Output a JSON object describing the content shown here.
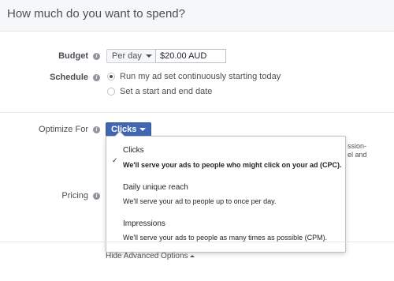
{
  "header": {
    "title": "How much do you want to spend?"
  },
  "budget": {
    "label": "Budget",
    "period_value": "Per day",
    "amount_value": "$20.00 AUD"
  },
  "schedule": {
    "label": "Schedule",
    "options": [
      {
        "label": "Run my ad set continuously starting today",
        "checked": true
      },
      {
        "label": "Set a start and end date",
        "checked": false
      }
    ]
  },
  "optimize": {
    "label": "Optimize For",
    "selected": "Clicks",
    "background_fragments": [
      "ssion-",
      "el and"
    ]
  },
  "pricing": {
    "label": "Pricing"
  },
  "dropdown": {
    "check_glyph": "✓",
    "options": [
      {
        "title": "Clicks",
        "description": "We'll serve your ads to people who might click on your ad (CPC).",
        "selected": true
      },
      {
        "title": "Daily unique reach",
        "description": "We'll serve your ad to people up to once per day.",
        "selected": false
      },
      {
        "title": "Impressions",
        "description": "We'll serve your ads to people as many times as possible (CPM).",
        "selected": false
      }
    ]
  },
  "footer": {
    "advanced_link": "Hide Advanced Options"
  },
  "info_glyph": "i",
  "colors": {
    "accent": "#4267b2",
    "text": "#4b4f56",
    "header_bg": "#f6f7f9"
  }
}
